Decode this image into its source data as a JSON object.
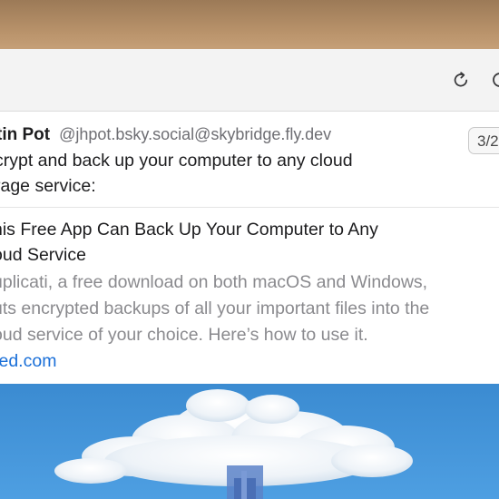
{
  "toolbar": {
    "reload_icon": "reload-icon",
    "partial_icon": "clock-icon"
  },
  "post": {
    "author": "tin Pot",
    "handle": "@jhpot.bsky.social@skybridge.fly.dev",
    "counter": "3/2",
    "text_lines": [
      "crypt and back up your computer to any cloud",
      "rage service:"
    ]
  },
  "card": {
    "title_lines": [
      "his Free App Can Back Up Your Computer to Any",
      "oud Service"
    ],
    "description_lines": [
      "uplicati, a free download on both macOS and Windows,",
      "uts encrypted backups of all your important files into the",
      "oud service of your choice. Here’s how to use it."
    ],
    "domain": "red.com"
  },
  "colors": {
    "accent_link": "#1a6fd8",
    "sky_top": "#3f8fd3",
    "sky_bottom": "#4f9ee0"
  }
}
